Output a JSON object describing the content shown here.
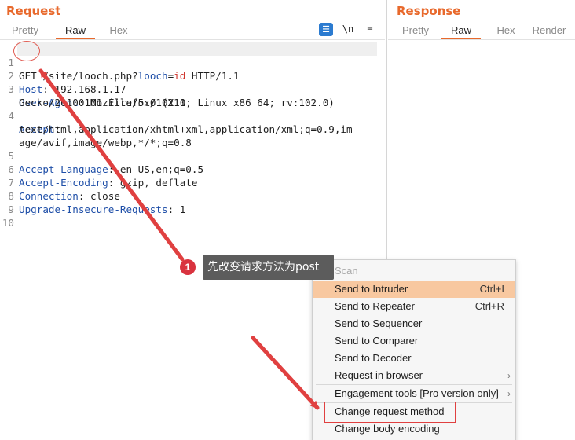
{
  "request": {
    "title": "Request",
    "tabs": [
      {
        "label": "Pretty",
        "active": false
      },
      {
        "label": "Raw",
        "active": true
      },
      {
        "label": "Hex",
        "active": false
      }
    ],
    "tools": {
      "wrap": "☰",
      "newline": "\\n",
      "menu": "≡"
    },
    "lines": [
      {
        "n": "1",
        "method": "GET",
        "rest_a": " /site/looch.php?",
        "param": "looch",
        "eq": "=",
        "val": "id",
        "rest_b": " HTTP/1.1"
      },
      {
        "n": "2",
        "name": "Host",
        "value": ": 192.168.1.17"
      },
      {
        "n": "3",
        "name": "User-Agent",
        "value": ": Mozilla/5.0 (X11; Linux x86_64; rv:102.0)"
      },
      {
        "n": "",
        "cont": "Gecko/20100101 Firefox/102.0"
      },
      {
        "n": "4",
        "name": "Accept",
        "value": ":"
      },
      {
        "n": "",
        "cont": "text/html,application/xhtml+xml,application/xml;q=0.9,im"
      },
      {
        "n": "",
        "cont": "age/avif,image/webp,*/*;q=0.8"
      },
      {
        "n": "5",
        "name": "Accept-Language",
        "value": ": en-US,en;q=0.5"
      },
      {
        "n": "6",
        "name": "Accept-Encoding",
        "value": ": gzip, deflate"
      },
      {
        "n": "7",
        "name": "Connection",
        "value": ": close"
      },
      {
        "n": "8",
        "name": "Upgrade-Insecure-Requests",
        "value": ": 1"
      },
      {
        "n": "9",
        "cont": ""
      },
      {
        "n": "10",
        "cont": ""
      }
    ]
  },
  "response": {
    "title": "Response",
    "tabs": [
      {
        "label": "Pretty",
        "active": false
      },
      {
        "label": "Raw",
        "active": true
      },
      {
        "label": "Hex",
        "active": false
      },
      {
        "label": "Render",
        "active": false
      }
    ]
  },
  "annotation": {
    "badge": "1",
    "tooltip": "先改变请求方法为post"
  },
  "context_menu": {
    "items": [
      {
        "label": "Scan",
        "shortcut": "",
        "submenu": false,
        "state": "disabled"
      },
      {
        "label": "Send to Intruder",
        "shortcut": "Ctrl+I",
        "submenu": false,
        "state": "highlighted"
      },
      {
        "label": "Send to Repeater",
        "shortcut": "Ctrl+R",
        "submenu": false,
        "state": "normal"
      },
      {
        "label": "Send to Sequencer",
        "shortcut": "",
        "submenu": false,
        "state": "normal"
      },
      {
        "label": "Send to Comparer",
        "shortcut": "",
        "submenu": false,
        "state": "normal"
      },
      {
        "label": "Send to Decoder",
        "shortcut": "",
        "submenu": false,
        "state": "normal"
      },
      {
        "label": "Request in browser",
        "shortcut": "",
        "submenu": true,
        "state": "normal"
      },
      {
        "label": "Engagement tools [Pro version only]",
        "shortcut": "",
        "submenu": true,
        "state": "normal"
      },
      {
        "label": "Change request method",
        "shortcut": "",
        "submenu": false,
        "state": "boxed"
      },
      {
        "label": "Change body encoding",
        "shortcut": "",
        "submenu": false,
        "state": "normal"
      }
    ],
    "submenu_arrow": "›"
  },
  "colors": {
    "accent": "#e8692c",
    "annotation_red": "#e04040",
    "menu_highlight": "#f8c8a0",
    "header_name": "#1f4fa8"
  }
}
